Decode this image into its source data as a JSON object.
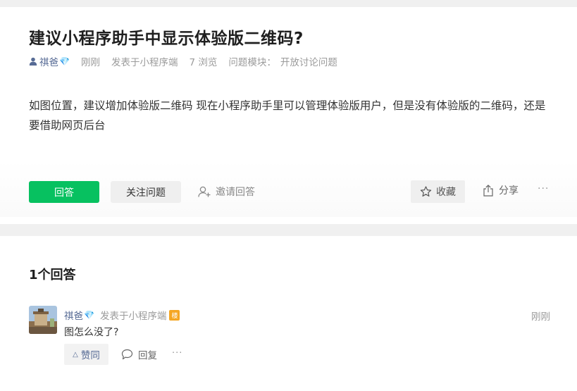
{
  "question": {
    "title": "建议小程序助手中显示体验版二维码?",
    "author": "祺爸",
    "author_badge_icon": "diamond-icon",
    "time": "刚刚",
    "posted_from": "发表于小程序端",
    "views": "7 浏览",
    "module_label": "问题模块：",
    "module_value": "开放讨论问题",
    "body": "如图位置，建议增加体验版二维码 现在小程序助手里可以管理体验版用户，但是没有体验版的二维码，还是要借助网页后台"
  },
  "actions": {
    "answer": "回答",
    "follow": "关注问题",
    "invite": "邀请回答",
    "collect": "收藏",
    "share": "分享",
    "more": "···"
  },
  "answers": {
    "count_label": "1个回答",
    "items": [
      {
        "author": "祺爸",
        "posted_from": "发表于小程序端",
        "floor_badge": "楼",
        "time": "刚刚",
        "text": "图怎么没了?",
        "like": "赞同",
        "reply": "回复",
        "more": "···"
      }
    ]
  },
  "colors": {
    "primary_green": "#07c160",
    "link_blue": "#576b95",
    "badge_orange": "#f5a623",
    "diamond_blue": "#3aa3ff"
  }
}
